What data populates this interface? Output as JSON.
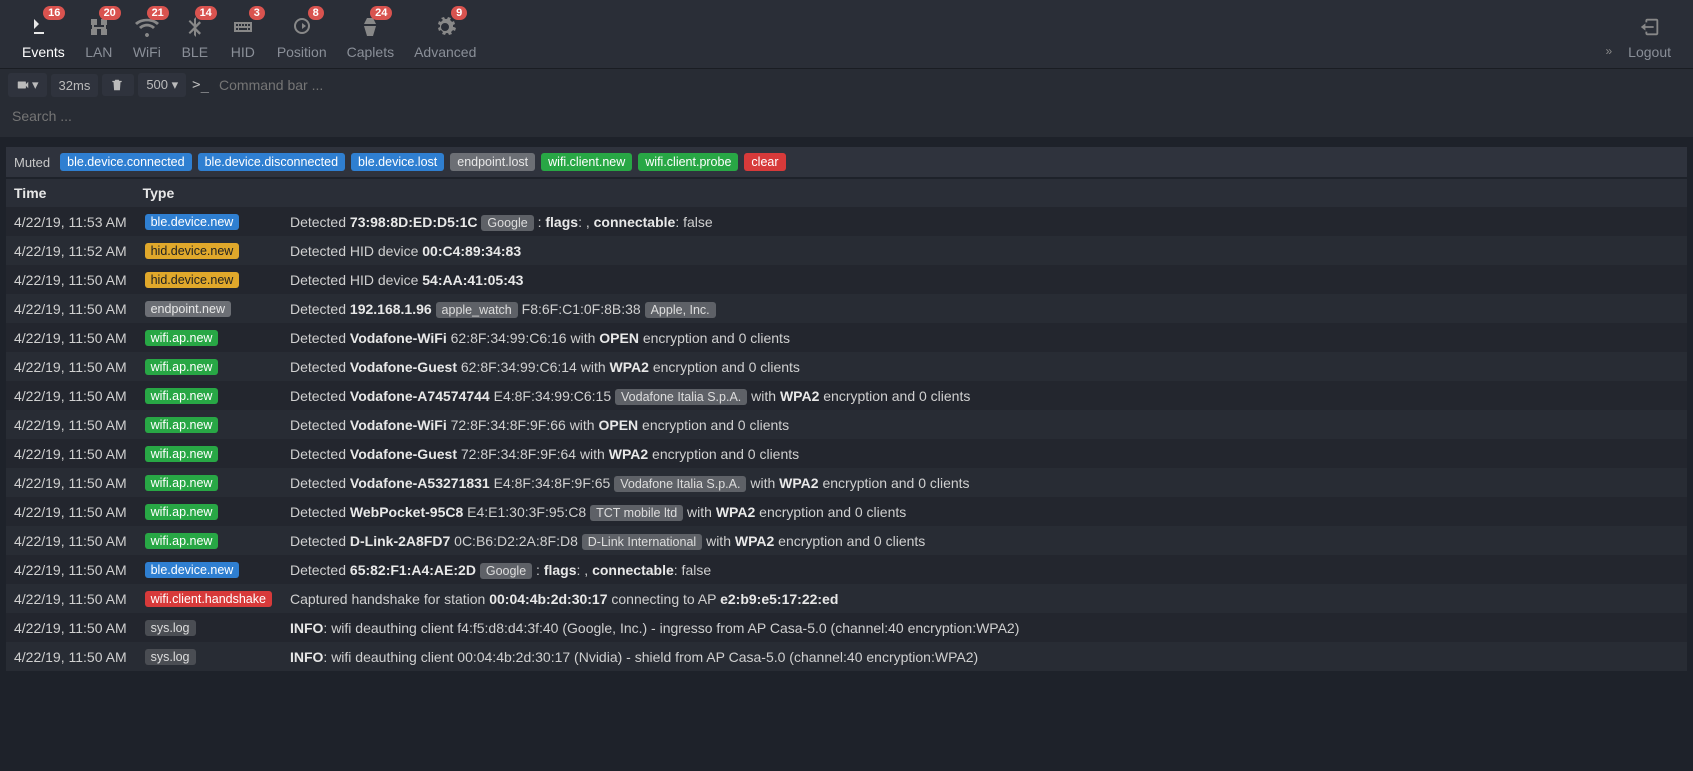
{
  "nav": [
    {
      "key": "events",
      "label": "Events",
      "badge": "16",
      "active": true
    },
    {
      "key": "lan",
      "label": "LAN",
      "badge": "20"
    },
    {
      "key": "wifi",
      "label": "WiFi",
      "badge": "21"
    },
    {
      "key": "ble",
      "label": "BLE",
      "badge": "14"
    },
    {
      "key": "hid",
      "label": "HID",
      "badge": "3"
    },
    {
      "key": "position",
      "label": "Position",
      "badge": "8"
    },
    {
      "key": "caplets",
      "label": "Caplets",
      "badge": "24"
    },
    {
      "key": "advanced",
      "label": "Advanced",
      "badge": "9"
    }
  ],
  "logout_label": "Logout",
  "toolbar": {
    "latency": "32ms",
    "limit": "500 ▾",
    "cmd_placeholder": "Command bar ...",
    "search_placeholder": "Search ..."
  },
  "muted": {
    "label": "Muted",
    "tags": [
      {
        "text": "ble.device.connected",
        "cls": "tag-blue"
      },
      {
        "text": "ble.device.disconnected",
        "cls": "tag-blue"
      },
      {
        "text": "ble.device.lost",
        "cls": "tag-blue"
      },
      {
        "text": "endpoint.lost",
        "cls": "tag-grey"
      },
      {
        "text": "wifi.client.new",
        "cls": "tag-green"
      },
      {
        "text": "wifi.client.probe",
        "cls": "tag-green"
      }
    ],
    "clear": "clear"
  },
  "columns": {
    "time": "Time",
    "type": "Type"
  },
  "events": [
    {
      "time": "4/22/19, 11:53 AM",
      "type": {
        "text": "ble.device.new",
        "cls": "tag-blue"
      },
      "parts": [
        {
          "t": "Detected "
        },
        {
          "t": "73:98:8D:ED:D5:1C",
          "b": true
        },
        {
          "t": " "
        },
        {
          "v": "Google"
        },
        {
          "t": " : "
        },
        {
          "t": "flags",
          "b": true
        },
        {
          "t": ": , "
        },
        {
          "t": "connectable",
          "b": true
        },
        {
          "t": ": false"
        }
      ]
    },
    {
      "time": "4/22/19, 11:52 AM",
      "type": {
        "text": "hid.device.new",
        "cls": "tag-yellow"
      },
      "parts": [
        {
          "t": "Detected HID device "
        },
        {
          "t": "00:C4:89:34:83",
          "b": true
        }
      ]
    },
    {
      "time": "4/22/19, 11:50 AM",
      "type": {
        "text": "hid.device.new",
        "cls": "tag-yellow"
      },
      "parts": [
        {
          "t": "Detected HID device "
        },
        {
          "t": "54:AA:41:05:43",
          "b": true
        }
      ]
    },
    {
      "time": "4/22/19, 11:50 AM",
      "type": {
        "text": "endpoint.new",
        "cls": "tag-grey"
      },
      "parts": [
        {
          "t": "Detected "
        },
        {
          "t": "192.168.1.96",
          "b": true
        },
        {
          "t": " "
        },
        {
          "v": "apple_watch"
        },
        {
          "t": " F8:6F:C1:0F:8B:38 "
        },
        {
          "v": "Apple, Inc."
        }
      ]
    },
    {
      "time": "4/22/19, 11:50 AM",
      "type": {
        "text": "wifi.ap.new",
        "cls": "tag-green"
      },
      "parts": [
        {
          "t": "Detected "
        },
        {
          "t": "Vodafone-WiFi",
          "b": true
        },
        {
          "t": " 62:8F:34:99:C6:16 with "
        },
        {
          "t": "OPEN",
          "b": true
        },
        {
          "t": " encryption and 0 clients"
        }
      ]
    },
    {
      "time": "4/22/19, 11:50 AM",
      "type": {
        "text": "wifi.ap.new",
        "cls": "tag-green"
      },
      "parts": [
        {
          "t": "Detected "
        },
        {
          "t": "Vodafone-Guest",
          "b": true
        },
        {
          "t": " 62:8F:34:99:C6:14 with "
        },
        {
          "t": "WPA2",
          "b": true
        },
        {
          "t": " encryption and 0 clients"
        }
      ]
    },
    {
      "time": "4/22/19, 11:50 AM",
      "type": {
        "text": "wifi.ap.new",
        "cls": "tag-green"
      },
      "parts": [
        {
          "t": "Detected "
        },
        {
          "t": "Vodafone-A74574744",
          "b": true
        },
        {
          "t": " E4:8F:34:99:C6:15 "
        },
        {
          "v": "Vodafone Italia S.p.A."
        },
        {
          "t": " with "
        },
        {
          "t": "WPA2",
          "b": true
        },
        {
          "t": " encryption and 0 clients"
        }
      ]
    },
    {
      "time": "4/22/19, 11:50 AM",
      "type": {
        "text": "wifi.ap.new",
        "cls": "tag-green"
      },
      "parts": [
        {
          "t": "Detected "
        },
        {
          "t": "Vodafone-WiFi",
          "b": true
        },
        {
          "t": " 72:8F:34:8F:9F:66 with "
        },
        {
          "t": "OPEN",
          "b": true
        },
        {
          "t": " encryption and 0 clients"
        }
      ]
    },
    {
      "time": "4/22/19, 11:50 AM",
      "type": {
        "text": "wifi.ap.new",
        "cls": "tag-green"
      },
      "parts": [
        {
          "t": "Detected "
        },
        {
          "t": "Vodafone-Guest",
          "b": true
        },
        {
          "t": " 72:8F:34:8F:9F:64 with "
        },
        {
          "t": "WPA2",
          "b": true
        },
        {
          "t": " encryption and 0 clients"
        }
      ]
    },
    {
      "time": "4/22/19, 11:50 AM",
      "type": {
        "text": "wifi.ap.new",
        "cls": "tag-green"
      },
      "parts": [
        {
          "t": "Detected "
        },
        {
          "t": "Vodafone-A53271831",
          "b": true
        },
        {
          "t": " E4:8F:34:8F:9F:65 "
        },
        {
          "v": "Vodafone Italia S.p.A."
        },
        {
          "t": " with "
        },
        {
          "t": "WPA2",
          "b": true
        },
        {
          "t": " encryption and 0 clients"
        }
      ]
    },
    {
      "time": "4/22/19, 11:50 AM",
      "type": {
        "text": "wifi.ap.new",
        "cls": "tag-green"
      },
      "parts": [
        {
          "t": "Detected "
        },
        {
          "t": "WebPocket-95C8",
          "b": true
        },
        {
          "t": " E4:E1:30:3F:95:C8 "
        },
        {
          "v": "TCT mobile ltd"
        },
        {
          "t": " with "
        },
        {
          "t": "WPA2",
          "b": true
        },
        {
          "t": " encryption and 0 clients"
        }
      ]
    },
    {
      "time": "4/22/19, 11:50 AM",
      "type": {
        "text": "wifi.ap.new",
        "cls": "tag-green"
      },
      "parts": [
        {
          "t": "Detected "
        },
        {
          "t": "D-Link-2A8FD7",
          "b": true
        },
        {
          "t": " 0C:B6:D2:2A:8F:D8 "
        },
        {
          "v": "D-Link International"
        },
        {
          "t": " with "
        },
        {
          "t": "WPA2",
          "b": true
        },
        {
          "t": " encryption and 0 clients"
        }
      ]
    },
    {
      "time": "4/22/19, 11:50 AM",
      "type": {
        "text": "ble.device.new",
        "cls": "tag-blue"
      },
      "parts": [
        {
          "t": "Detected "
        },
        {
          "t": "65:82:F1:A4:AE:2D",
          "b": true
        },
        {
          "t": " "
        },
        {
          "v": "Google"
        },
        {
          "t": " : "
        },
        {
          "t": "flags",
          "b": true
        },
        {
          "t": ": , "
        },
        {
          "t": "connectable",
          "b": true
        },
        {
          "t": ": false"
        }
      ]
    },
    {
      "time": "4/22/19, 11:50 AM",
      "type": {
        "text": "wifi.client.handshake",
        "cls": "tag-red"
      },
      "parts": [
        {
          "t": "Captured handshake for station "
        },
        {
          "t": "00:04:4b:2d:30:17",
          "b": true
        },
        {
          "t": " connecting to AP "
        },
        {
          "t": "e2:b9:e5:17:22:ed",
          "b": true
        }
      ]
    },
    {
      "time": "4/22/19, 11:50 AM",
      "type": {
        "text": "sys.log",
        "cls": "tag-darkgrey"
      },
      "parts": [
        {
          "t": "INFO",
          "b": true
        },
        {
          "t": ": wifi deauthing client f4:f5:d8:d4:3f:40 (Google, Inc.) - ingresso from AP Casa-5.0 (channel:40 encryption:WPA2)"
        }
      ]
    },
    {
      "time": "4/22/19, 11:50 AM",
      "type": {
        "text": "sys.log",
        "cls": "tag-darkgrey"
      },
      "parts": [
        {
          "t": "INFO",
          "b": true
        },
        {
          "t": ": wifi deauthing client 00:04:4b:2d:30:17 (Nvidia) - shield from AP Casa-5.0 (channel:40 encryption:WPA2)"
        }
      ]
    }
  ]
}
